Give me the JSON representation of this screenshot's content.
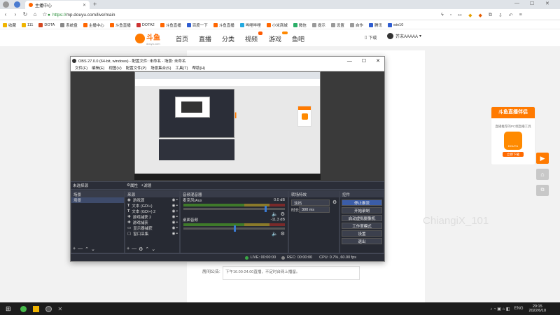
{
  "browser": {
    "tab_title": "主播中心",
    "new_tab": "+",
    "url_https": "https://",
    "url_rest": "mp.douyu.com/live/main",
    "window_controls": [
      "—",
      "☐",
      "✕"
    ]
  },
  "bookmarks": [
    {
      "label": "收藏",
      "color": "#f0b400"
    },
    {
      "label": "111",
      "color": "#f0b400"
    },
    {
      "label": "DOTA",
      "color": "#d4471f"
    },
    {
      "label": "系统盘",
      "color": "#888"
    },
    {
      "label": "主播中心",
      "color": "#f60"
    },
    {
      "label": "斗鱼直播",
      "color": "#f60"
    },
    {
      "label": "DOTA2",
      "color": "#c33"
    },
    {
      "label": "斗鱼直播",
      "color": "#f60"
    },
    {
      "label": "百度一下",
      "color": "#2e5cd0"
    },
    {
      "label": "斗鱼直播",
      "color": "#f60"
    },
    {
      "label": "哔哩哔哩",
      "color": "#22a9e0"
    },
    {
      "label": "小米商城",
      "color": "#f60"
    },
    {
      "label": "微信",
      "color": "#2aae67"
    },
    {
      "label": "提示",
      "color": "#999"
    },
    {
      "label": "设置",
      "color": "#999"
    },
    {
      "label": "自作",
      "color": "#999"
    },
    {
      "label": "腾讯",
      "color": "#2e5cd0"
    },
    {
      "label": "win10",
      "color": "#2e5cd0"
    }
  ],
  "site": {
    "logo": "斗鱼",
    "logo_sub": "douyu.com",
    "nav": [
      "首页",
      "直播",
      "分类",
      "视频",
      "游戏",
      "鱼吧"
    ],
    "download": "下载",
    "username": "芥末AAAAA",
    "notice_label": "房间公告:",
    "notice_text": "下午16.00-24.00直播，不定时台网上播留。",
    "watermark": "ChiangiX_101"
  },
  "ad": {
    "title": "斗鱼直播伴侣",
    "subtitle": "直播推荐的PC端直播工具",
    "button": "立即下载",
    "app_name": "DOUYU"
  },
  "obs": {
    "title": "OBS 27.0.0 (64-bit, windows) - 配置文件: 未命名 - 场景: 未命名",
    "menu": [
      "文件(F)",
      "编辑(E)",
      "视图(V)",
      "配置文件(P)",
      "场景集合(S)",
      "工具(T)",
      "帮助(H)"
    ],
    "no_source": "未选择源",
    "props": "属性",
    "filters": "滤镜",
    "docks": {
      "scenes": {
        "title": "场景",
        "items": [
          "场景"
        ]
      },
      "sources": {
        "title": "来源",
        "items": [
          "游戏源",
          "文本 (GDI+)",
          "文本 (GDI+) 2",
          "游戏捕获 2",
          "游戏捕获",
          "显示器捕获",
          "窗口采集"
        ]
      },
      "mixer": {
        "title": "音频混音器",
        "tracks": [
          {
            "name": "麦克风/Aux",
            "db": "0.0 dB"
          },
          {
            "name": "桌面音频",
            "db": "-11.3 dB"
          }
        ]
      },
      "transitions": {
        "title": "转场特效",
        "type": "淡出",
        "duration_label": "时长",
        "duration": "300 ms"
      },
      "controls": {
        "title": "控件",
        "buttons": [
          "停止推流",
          "开始录制",
          "启动虚拟摄像机",
          "工作室模式",
          "设置",
          "退出"
        ]
      }
    },
    "status": {
      "live": "LIVE: 00:00:00",
      "rec": "REC: 00:00:00",
      "cpu": "CPU: 0.7%, 60.00 fps"
    }
  },
  "taskbar": {
    "time": "20:15",
    "date": "2022/6/10",
    "tray": "ENG"
  }
}
